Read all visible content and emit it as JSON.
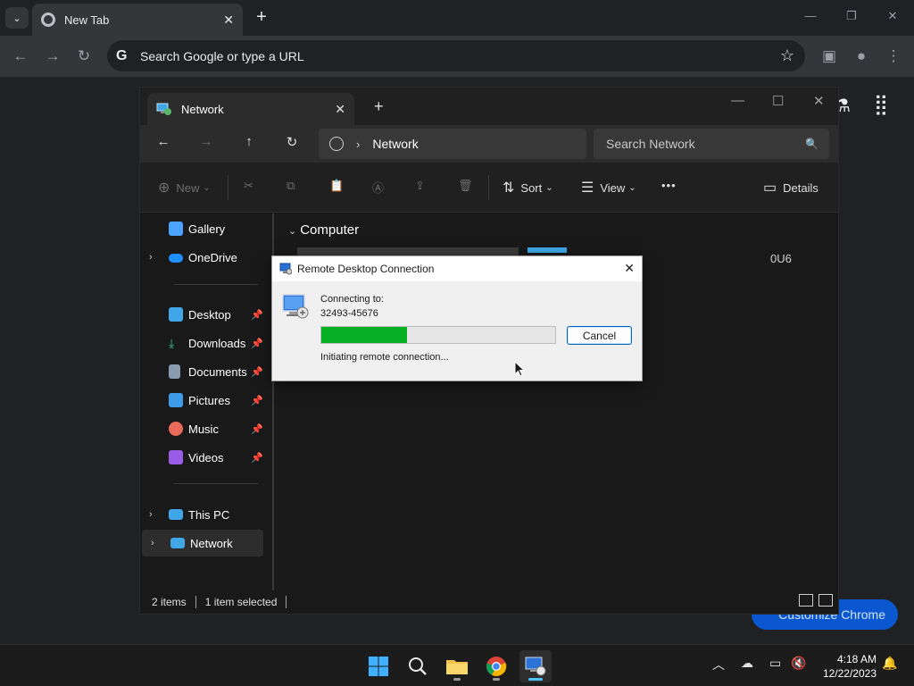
{
  "browser": {
    "tab": {
      "title": "New Tab",
      "close_glyph": "✕"
    },
    "tab_search_glyph": "⌄",
    "new_tab_glyph": "+",
    "omnibox": {
      "logo": "G",
      "placeholder": "Search Google or type a URL"
    },
    "customize_label": "Customize Chrome"
  },
  "explorer": {
    "tab_title": "Network",
    "breadcrumb": [
      "Network"
    ],
    "search_placeholder": "Search Network",
    "commands": {
      "new": "New",
      "sort": "Sort",
      "view": "View",
      "more": "•••",
      "details": "Details"
    },
    "sidebar": {
      "items": [
        {
          "label": "Gallery",
          "icon": "gallery-icon",
          "color": "#4aa3ff"
        },
        {
          "label": "OneDrive",
          "icon": "onedrive-icon",
          "color": "#1e90ff"
        },
        {
          "label": "Desktop",
          "icon": "desktop-icon",
          "color": "#3fa6e8",
          "pinned": true
        },
        {
          "label": "Downloads",
          "icon": "download-icon",
          "color": "#3cc38a",
          "pinned": true
        },
        {
          "label": "Documents",
          "icon": "documents-icon",
          "color": "#8a9bb0",
          "pinned": true
        },
        {
          "label": "Pictures",
          "icon": "pictures-icon",
          "color": "#3d9be9",
          "pinned": true
        },
        {
          "label": "Music",
          "icon": "music-icon",
          "color": "#e96a5a",
          "pinned": true
        },
        {
          "label": "Videos",
          "icon": "videos-icon",
          "color": "#9b5de5",
          "pinned": true
        },
        {
          "label": "This PC",
          "icon": "this-pc-icon",
          "color": "#3fa6e8"
        },
        {
          "label": "Network",
          "icon": "network-icon",
          "color": "#3fa6e8"
        }
      ]
    },
    "group_header": "Computer",
    "partial_item_text": "0U6",
    "status": {
      "items": "2 items",
      "selected": "1 item selected"
    }
  },
  "rdp_dialog": {
    "title": "Remote Desktop Connection",
    "connecting_label": "Connecting to:",
    "target": "32493-45676",
    "progress_fraction": 0.365,
    "progress_color": "#06b025",
    "status": "Initiating remote connection...",
    "cancel_label": "Cancel"
  },
  "taskbar": {
    "apps": [
      "windows-start-icon",
      "search-icon",
      "file-explorer-icon",
      "chrome-icon",
      "remote-desktop-icon"
    ],
    "clock": {
      "time": "4:18 AM",
      "date": "12/22/2023"
    }
  }
}
